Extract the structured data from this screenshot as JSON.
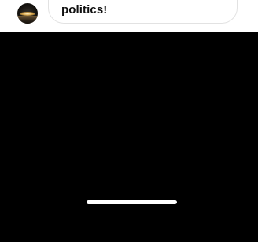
{
  "message": {
    "text": "politics!"
  },
  "colors": {
    "bubble_border": "#e2e2e2",
    "video_background": "#000000",
    "home_indicator": "#ffffff"
  }
}
